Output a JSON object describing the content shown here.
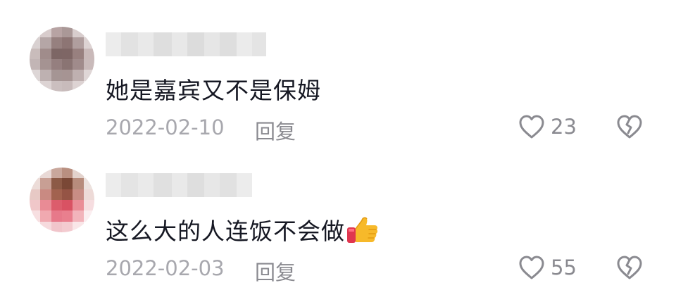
{
  "comments": [
    {
      "text": "她是嘉宾又不是保姆",
      "date": "2022-02-10",
      "reply_label": "回复",
      "likes": "23",
      "emoji": ""
    },
    {
      "text": "这么大的人连饭不会做",
      "date": "2022-02-03",
      "reply_label": "回复",
      "likes": "55",
      "emoji": "thumbs-up-icon"
    }
  ],
  "colors": {
    "text_primary": "#161823",
    "text_secondary": "#a8a8ae",
    "icon": "#8a8a90"
  }
}
